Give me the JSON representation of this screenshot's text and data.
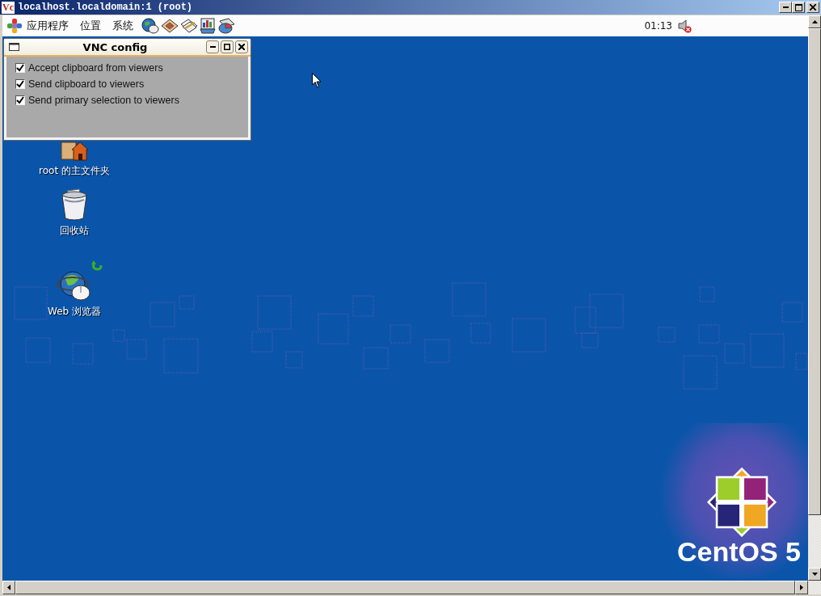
{
  "window": {
    "icon_text": "Vc",
    "title": "localhost.localdomain:1 (root)"
  },
  "panel": {
    "menus": [
      {
        "label": "应用程序"
      },
      {
        "label": "位置"
      },
      {
        "label": "系统"
      }
    ],
    "clock": "01:13"
  },
  "dialog": {
    "title": "VNC config",
    "options": [
      {
        "label": "Accept clipboard from viewers",
        "checked": true
      },
      {
        "label": "Send clipboard to viewers",
        "checked": true
      },
      {
        "label": "Send primary selection to viewers",
        "checked": true
      }
    ]
  },
  "desktop_icons": [
    {
      "kind": "home",
      "label": "root 的主文件夹"
    },
    {
      "kind": "trash",
      "label": "回收站"
    },
    {
      "kind": "browser",
      "label": "Web 浏览器"
    }
  ],
  "wallpaper": {
    "logo_text": "CentOS 5"
  }
}
